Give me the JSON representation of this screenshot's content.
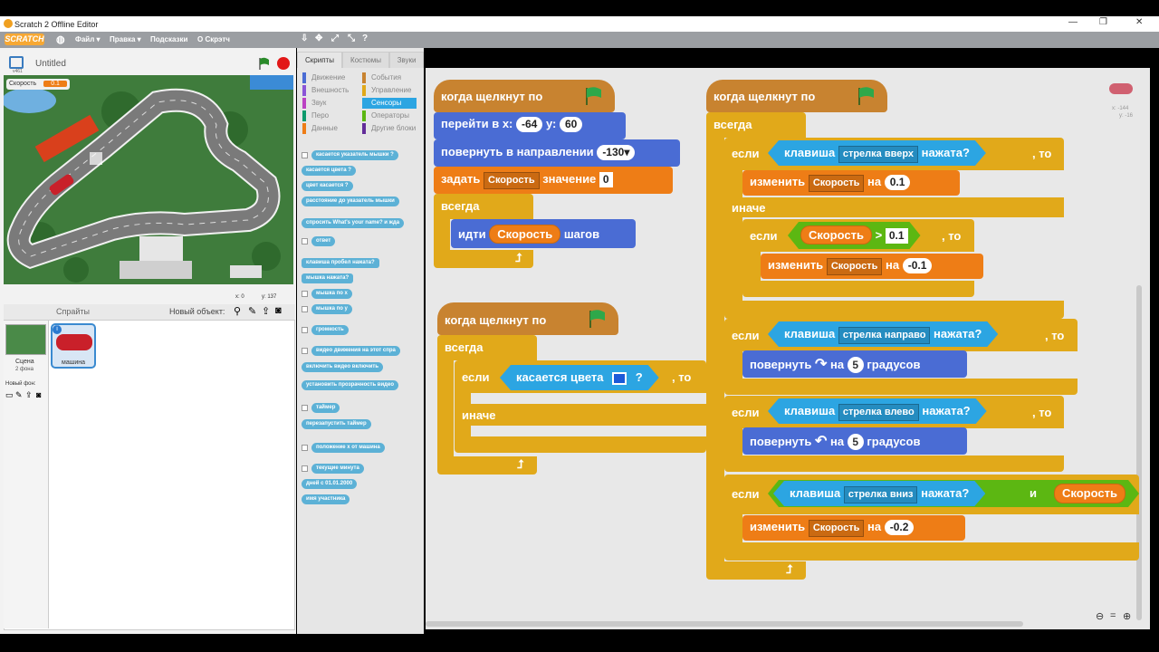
{
  "window": {
    "title": "Scratch 2 Offline Editor",
    "min": "—",
    "max": "❐",
    "close": "✕"
  },
  "menu": {
    "logo": "SCRATCH",
    "file": "Файл ▾",
    "edit": "Правка ▾",
    "tips": "Подсказки",
    "about": "О Скрэтч"
  },
  "stage": {
    "project_title": "Untitled",
    "version": "v461",
    "var_label": "Скорость",
    "var_value": "0.1",
    "coords_x": "x: 0",
    "coords_y": "y: 137"
  },
  "sprites": {
    "header": "Спрайты",
    "new_object": "Новый объект:",
    "scene_label": "Сцена",
    "scene_backdrops": "2 фона",
    "new_bg": "Новый фон:",
    "sprite_name": "машина",
    "badge": "i"
  },
  "tabs": {
    "scripts": "Скрипты",
    "costumes": "Костюмы",
    "sounds": "Звуки"
  },
  "categories": [
    {
      "label": "Движение",
      "color": "#4a6cd4"
    },
    {
      "label": "События",
      "color": "#c88330"
    },
    {
      "label": "Внешность",
      "color": "#8a55d7"
    },
    {
      "label": "Управление",
      "color": "#e1a91a"
    },
    {
      "label": "Звук",
      "color": "#bb42c3"
    },
    {
      "label": "Сенсоры",
      "color": "#2ca5e2"
    },
    {
      "label": "Перо",
      "color": "#0e9a6c"
    },
    {
      "label": "Операторы",
      "color": "#5cb712"
    },
    {
      "label": "Данные",
      "color": "#ee7d16"
    },
    {
      "label": "Другие блоки",
      "color": "#632d99"
    }
  ],
  "palette": [
    "касается указатель мышки ?",
    "касается цвета ?",
    "цвет касается ?",
    "расстояние до указатель мышки",
    "спросить What's your name? и жда",
    "ответ",
    "клавиша пробел нажата?",
    "мышка нажата?",
    "мышка по x",
    "мышка по y",
    "громкость",
    "видео движения на этот спра",
    "включить видео включить",
    "установить прозрачность видео",
    "таймер",
    "перезапустить таймер",
    "положение x от машина",
    "текущие минута",
    "дней с 01.01.2000",
    "имя участника"
  ],
  "script1": {
    "hat": "когда щелкнут по",
    "goto_label": "перейти в x:",
    "goto_x": "-64",
    "goto_y_label": "у:",
    "goto_y": "60",
    "turn_label": "повернуть в направлении",
    "turn_val": "-130▾",
    "set_label": "задать",
    "set_var": "Скорость",
    "set_value_label": "значение",
    "set_value": "0",
    "forever": "всегда",
    "move_label": "идти",
    "move_var": "Скорость",
    "move_suffix": "шагов"
  },
  "script2": {
    "hat": "когда щелкнут по",
    "forever": "всегда",
    "if": "если",
    "touching": "касается цвета",
    "q": "?",
    "then": ", то",
    "else": "иначе"
  },
  "script3": {
    "hat": "когда щелкнут по",
    "forever": "всегда",
    "if1": "если",
    "key1_label": "клавиша",
    "key1": "стрелка вверх",
    "pressed": "нажата?",
    "then": ", то",
    "change1_label": "изменить",
    "change1_var": "Скорость",
    "by": "на",
    "change1_val": "0.1",
    "else": "иначе",
    "if2": "если",
    "gt_var": "Скорость",
    "gt": ">",
    "gt_val": "0.1",
    "change2_val": "-0.1",
    "if3": "если",
    "key3": "стрелка направо",
    "turn_label": "повернуть",
    "turn_deg": "5",
    "degrees": "градусов",
    "if4": "если",
    "key4": "стрелка влево",
    "if5": "если",
    "key5": "стрелка вниз",
    "and": "и",
    "and_var": "Скорость",
    "change5_val": "-0.2"
  },
  "scriptarea": {
    "coords_x": "x: -144",
    "coords_y": "y: -16"
  }
}
